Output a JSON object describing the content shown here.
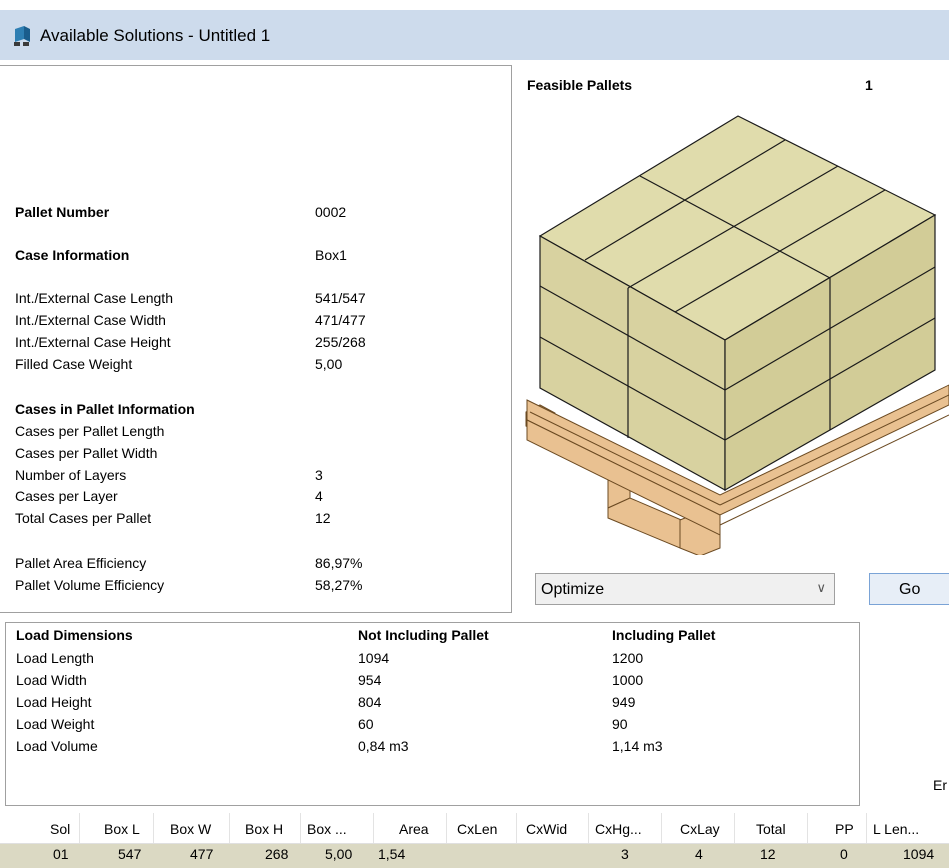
{
  "window": {
    "title": "Available Solutions - Untitled 1"
  },
  "pallet_info": {
    "pallet_number": {
      "label": "Pallet Number",
      "value": "0002"
    },
    "case_information": {
      "label": "Case Information",
      "value": "Box1"
    },
    "case_dims": [
      {
        "label": "Int./External Case Length",
        "value": "541/547"
      },
      {
        "label": "Int./External Case Width",
        "value": "471/477"
      },
      {
        "label": "Int./External Case Height",
        "value": "255/268"
      },
      {
        "label": "Filled Case Weight",
        "value": "5,00"
      }
    ],
    "cases_header": "Cases in Pallet Information",
    "cases_rows": [
      {
        "label": "Cases per Pallet Length",
        "value": ""
      },
      {
        "label": "Cases per Pallet Width",
        "value": ""
      },
      {
        "label": "Number of Layers",
        "value": "3"
      },
      {
        "label": "Cases per Layer",
        "value": "4"
      },
      {
        "label": "Total Cases per Pallet",
        "value": "12"
      }
    ],
    "efficiency": [
      {
        "label": "Pallet Area Efficiency",
        "value": "86,97%"
      },
      {
        "label": "Pallet Volume Efficiency",
        "value": "58,27%"
      }
    ]
  },
  "feasible": {
    "label": "Feasible Pallets",
    "count": "1"
  },
  "optimize": {
    "selected": "Optimize",
    "go_label": "Go"
  },
  "load": {
    "headers": {
      "title": "Load Dimensions",
      "not_incl": "Not Including Pallet",
      "incl": "Including Pallet"
    },
    "rows": [
      {
        "label": "Load Length",
        "not_incl": "1094",
        "incl": "1200"
      },
      {
        "label": "Load Width",
        "not_incl": "954",
        "incl": "1000"
      },
      {
        "label": "Load Height",
        "not_incl": "804",
        "incl": "949"
      },
      {
        "label": "Load Weight",
        "not_incl": "60",
        "incl": "90"
      },
      {
        "label": "Load Volume",
        "not_incl": "0,84 m3",
        "incl": "1,14 m3"
      }
    ]
  },
  "cutoff_text": "Er",
  "grid": {
    "columns": [
      "Sol",
      "Box L",
      "Box W",
      "Box H",
      "Box ...",
      "Area",
      "CxLen",
      "CxWid",
      "CxHg...",
      "CxLay",
      "Total",
      "PP",
      "L Len..."
    ],
    "rows": [
      [
        "01",
        "547",
        "477",
        "268",
        "5,00",
        "1,54",
        "",
        "",
        "3",
        "4",
        "12",
        "0",
        "1094"
      ]
    ]
  },
  "colors": {
    "case": "#e0dcac",
    "pallet": "#e9c191",
    "row_highlight": "#dbd9c3",
    "titlebar": "#cddbec"
  },
  "icons": {
    "title": "app-icon",
    "combo": "chevron-down-icon"
  }
}
